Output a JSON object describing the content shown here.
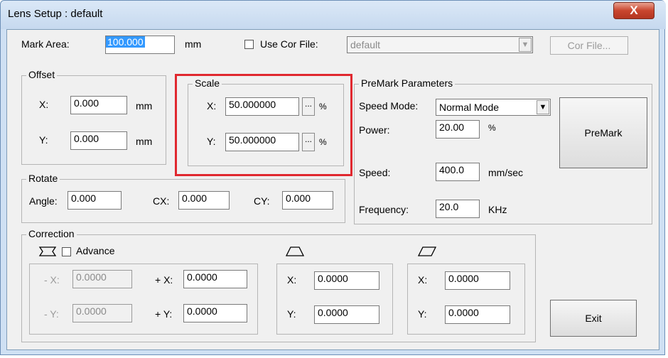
{
  "window": {
    "title": "Lens Setup : default",
    "close_label": "X"
  },
  "mark_area": {
    "label": "Mark Area:",
    "value": "100.000",
    "unit": "mm"
  },
  "cor_file": {
    "checkbox_label": "Use Cor File:",
    "select_value": "default",
    "button_label": "Cor File..."
  },
  "offset": {
    "legend": "Offset",
    "x_label": "X:",
    "x_value": "0.000",
    "x_unit": "mm",
    "y_label": "Y:",
    "y_value": "0.000",
    "y_unit": "mm"
  },
  "scale": {
    "legend": "Scale",
    "x_label": "X:",
    "x_value": "50.000000",
    "y_label": "Y:",
    "y_value": "50.000000",
    "unit": "%",
    "dots": "..."
  },
  "premark": {
    "legend": "PreMark Parameters",
    "speed_mode_label": "Speed Mode:",
    "speed_mode_value": "Normal Mode",
    "power_label": "Power:",
    "power_value": "20.00",
    "power_unit": "%",
    "speed_label": "Speed:",
    "speed_value": "400.0",
    "speed_unit": "mm/sec",
    "frequency_label": "Frequency:",
    "frequency_value": "20.0",
    "frequency_unit": "KHz",
    "button_label": "PreMark"
  },
  "rotate": {
    "legend": "Rotate",
    "angle_label": "Angle:",
    "angle_value": "0.000",
    "cx_label": "CX:",
    "cx_value": "0.000",
    "cy_label": "CY:",
    "cy_value": "0.000"
  },
  "correction": {
    "legend": "Correction",
    "advance_label": "Advance",
    "minus_x_label": "- X:",
    "minus_x_value": "0.0000",
    "minus_y_label": "- Y:",
    "minus_y_value": "0.0000",
    "plus_x_label": "+ X:",
    "plus_x_value": "0.0000",
    "plus_y_label": "+ Y:",
    "plus_y_value": "0.0000",
    "trapezoid": {
      "x_label": "X:",
      "x_value": "0.0000",
      "y_label": "Y:",
      "y_value": "0.0000"
    },
    "parallelogram": {
      "x_label": "X:",
      "x_value": "0.0000",
      "y_label": "Y:",
      "y_value": "0.0000"
    }
  },
  "exit_label": "Exit",
  "colors": {
    "highlight": "#e0282f",
    "selection": "#3399ff",
    "close_button": "#c9452e"
  }
}
